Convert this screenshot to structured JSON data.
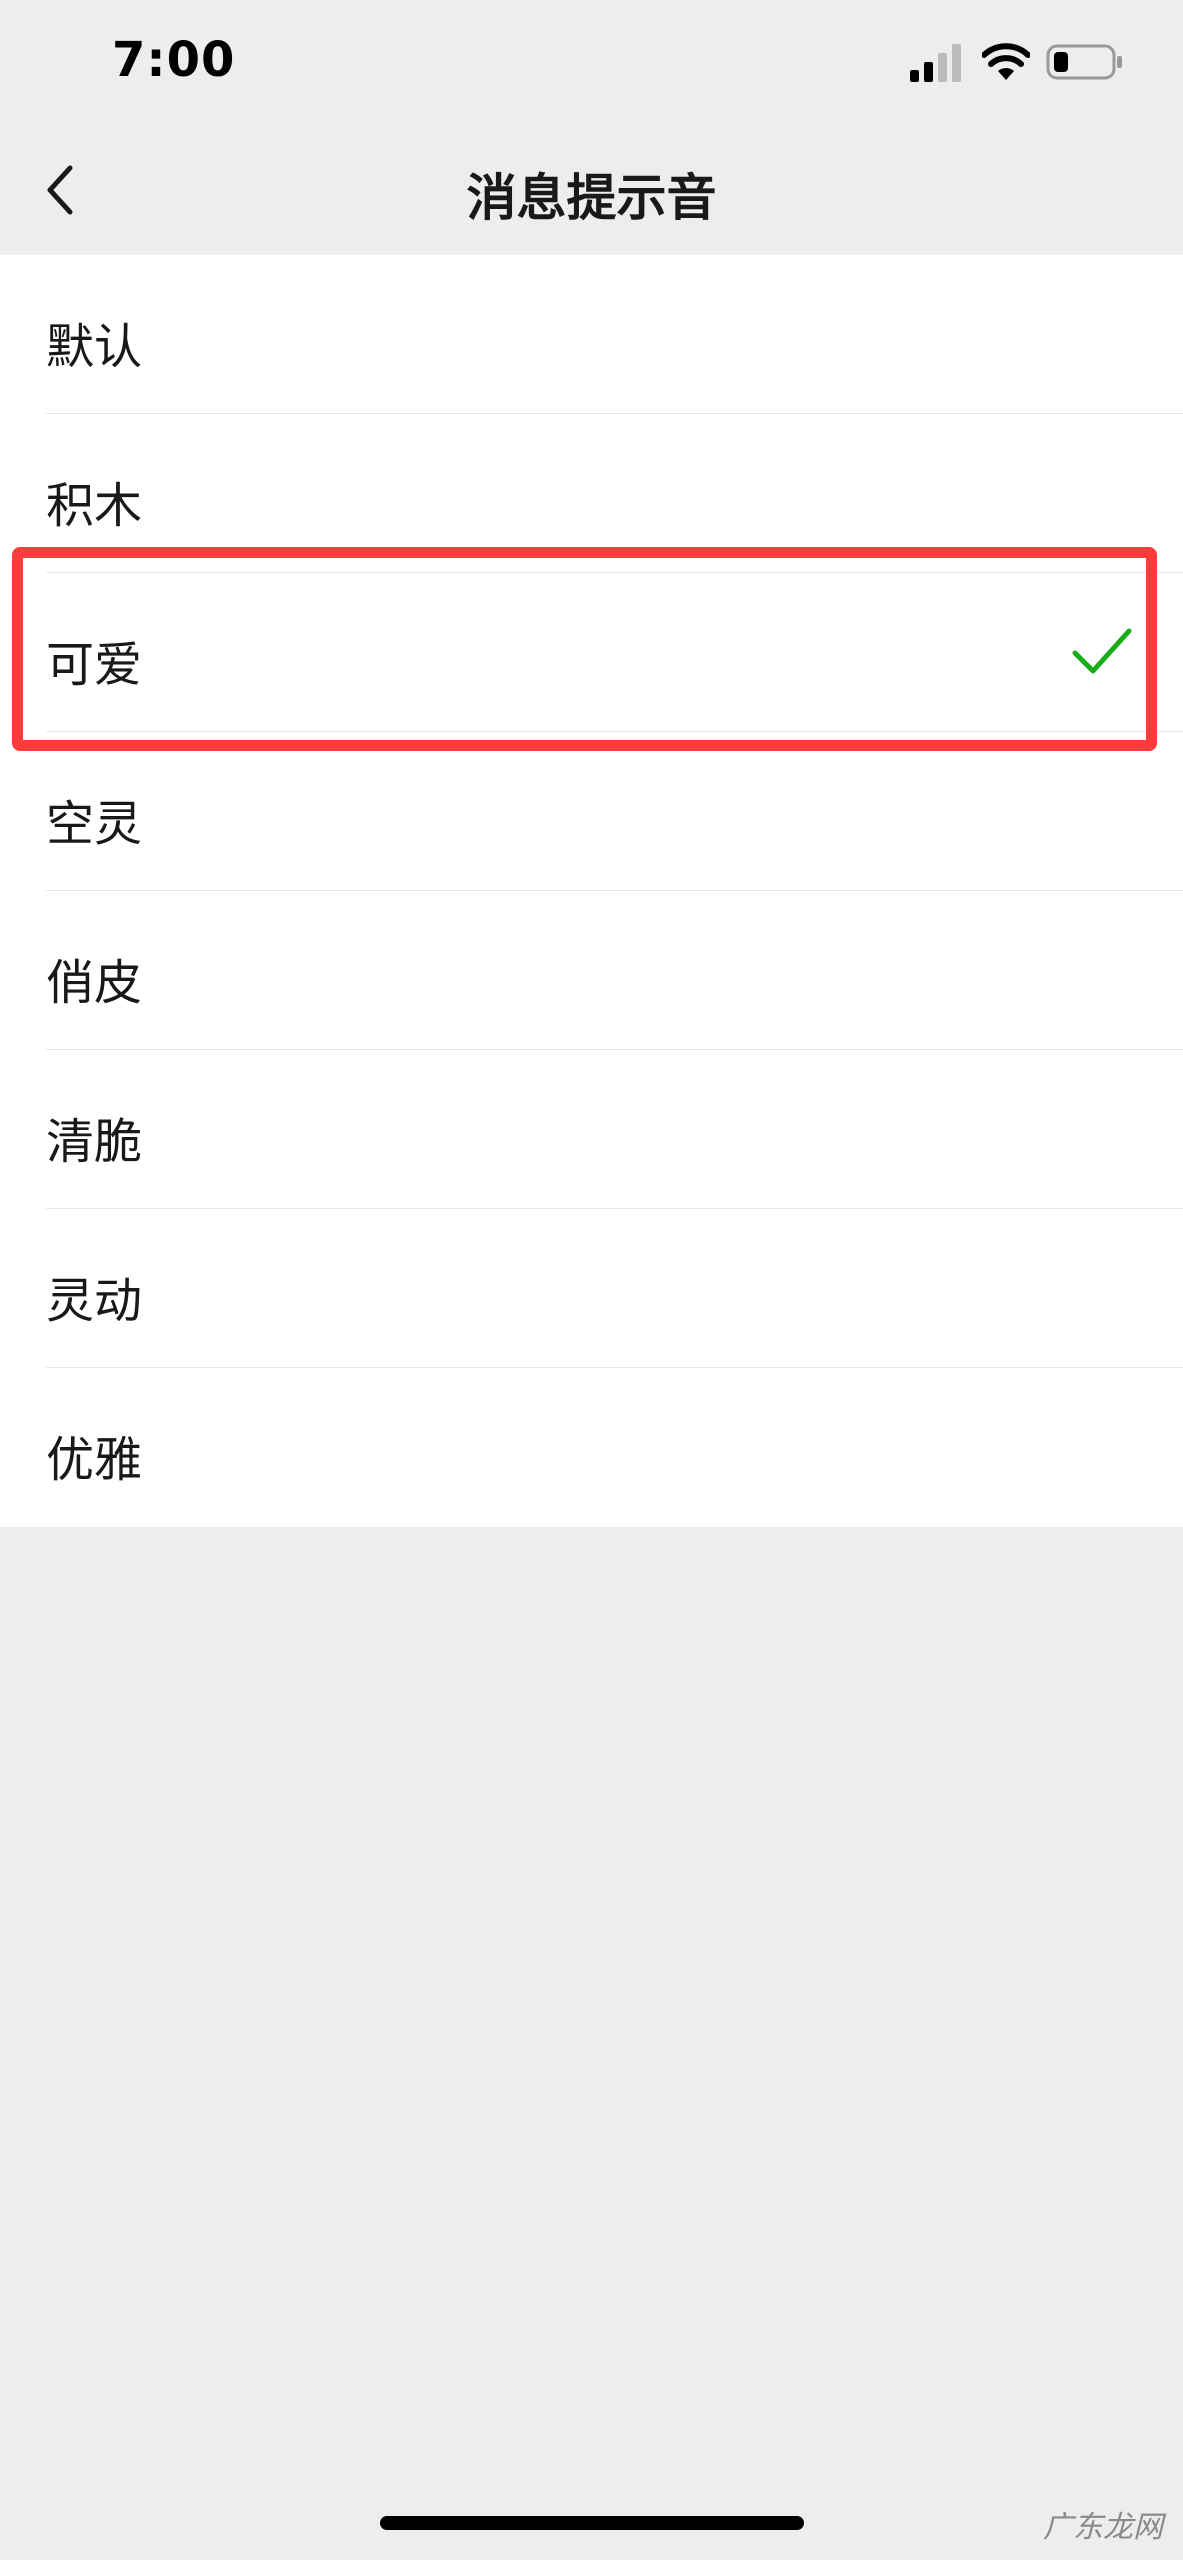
{
  "status_bar": {
    "time": "7:00",
    "icons": [
      "signal-icon",
      "wifi-icon",
      "battery-icon"
    ]
  },
  "nav": {
    "back_icon": "chevron-left-icon",
    "title": "消息提示音"
  },
  "sounds": [
    {
      "label": "默认",
      "selected": false
    },
    {
      "label": "积木",
      "selected": false
    },
    {
      "label": "可爱",
      "selected": true
    },
    {
      "label": "空灵",
      "selected": false
    },
    {
      "label": "俏皮",
      "selected": false
    },
    {
      "label": "清脆",
      "selected": false
    },
    {
      "label": "灵动",
      "selected": false
    },
    {
      "label": "优雅",
      "selected": false
    }
  ],
  "colors": {
    "check": "#1aad19",
    "highlight": "#ff3b3b",
    "background": "#ededed"
  },
  "watermark": "广东龙网"
}
